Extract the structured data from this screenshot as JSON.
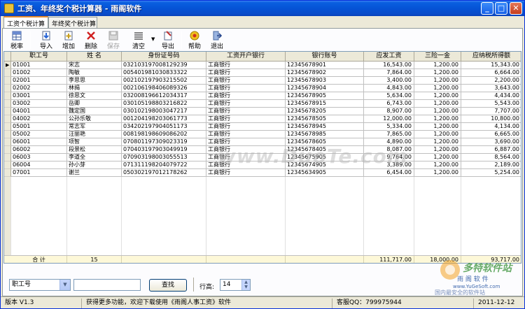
{
  "window": {
    "title": "工资、年终奖个税计算器 - 雨阁软件",
    "min_glyph": "_",
    "max_glyph": "□",
    "close_glyph": "✕"
  },
  "tabs": [
    {
      "label": "工资个税计算",
      "active": true
    },
    {
      "label": "年终奖个税计算",
      "active": false
    }
  ],
  "toolbar": {
    "items": [
      {
        "label": "税率",
        "icon": "tax-rate-table-icon",
        "enabled": true
      },
      {
        "label": "导入",
        "icon": "import-icon",
        "enabled": true
      },
      {
        "label": "增加",
        "icon": "add-icon",
        "enabled": true
      },
      {
        "label": "删除",
        "icon": "delete-icon",
        "enabled": true
      },
      {
        "label": "保存",
        "icon": "save-icon",
        "enabled": false
      },
      {
        "label": "清空",
        "icon": "clear-icon",
        "enabled": true
      },
      {
        "label": "导出",
        "icon": "export-icon",
        "enabled": true
      },
      {
        "label": "帮助",
        "icon": "help-icon",
        "enabled": true
      },
      {
        "label": "退出",
        "icon": "exit-icon",
        "enabled": true
      }
    ],
    "clear_dropdown_glyph": "▼"
  },
  "grid": {
    "columns": [
      "职工号",
      "姓 名",
      "身份证号码",
      "工资开户银行",
      "银行账号",
      "应发工资",
      "三险一金",
      "应纳税所得额"
    ],
    "current_row_marker": "▶",
    "rows": [
      [
        "01001",
        "宋志",
        "032103197008129239",
        "工商银行",
        "12345678901",
        "16,543.00",
        "1,200.00",
        "15,343.00"
      ],
      [
        "01002",
        "陶敏",
        "005401981030833322",
        "工商银行",
        "12345678902",
        "7,864.00",
        "1,200.00",
        "6,664.00"
      ],
      [
        "02001",
        "李思思",
        "002102197903215502",
        "工商银行",
        "12345678903",
        "3,400.00",
        "1,200.00",
        "2,200.00"
      ],
      [
        "02002",
        "林揭",
        "002106198406089326",
        "工商银行",
        "12345678904",
        "4,843.00",
        "1,200.00",
        "3,643.00"
      ],
      [
        "03001",
        "徐思文",
        "032008196612034317",
        "工商银行",
        "12345678905",
        "5,634.00",
        "1,200.00",
        "4,434.00"
      ],
      [
        "03002",
        "岳卿",
        "030105198803216822",
        "工商银行",
        "12345678915",
        "6,743.00",
        "1,200.00",
        "5,543.00"
      ],
      [
        "04001",
        "魏定国",
        "030102198003047217",
        "工商银行",
        "12345678205",
        "8,907.00",
        "1,200.00",
        "7,707.00"
      ],
      [
        "04002",
        "公孙乐敬",
        "001204198203061773",
        "工商银行",
        "12345678505",
        "12,000.00",
        "1,200.00",
        "10,800.00"
      ],
      [
        "05001",
        "常志军",
        "034202197904051173",
        "工商银行",
        "12345678945",
        "5,334.00",
        "1,200.00",
        "4,134.00"
      ],
      [
        "05002",
        "汪丽艳",
        "008198198609086202",
        "工商银行",
        "12345678985",
        "7,865.00",
        "1,200.00",
        "6,665.00"
      ],
      [
        "06001",
        "项智",
        "070801197309023319",
        "工商银行",
        "12345678605",
        "4,890.00",
        "1,200.00",
        "3,690.00"
      ],
      [
        "06002",
        "段景松",
        "070403197903049919",
        "工商银行",
        "12345678405",
        "8,087.00",
        "1,200.00",
        "6,887.00"
      ],
      [
        "06003",
        "李道全",
        "070903198003055513",
        "工商银行",
        "12345675905",
        "9,764.00",
        "1,200.00",
        "8,564.00"
      ],
      [
        "06004",
        "孙小芽",
        "071311198204079722",
        "工商银行",
        "12345674905",
        "3,389.00",
        "1,200.00",
        "2,189.00"
      ],
      [
        "07001",
        "谢兰",
        "050302197012178262",
        "工商银行",
        "12345634905",
        "6,454.00",
        "1,200.00",
        "5,254.00"
      ]
    ],
    "summary": {
      "label": "合 计",
      "count": "15",
      "gross_total": "111,717.00",
      "insurance_total": "18,000.00",
      "taxable_total": "93,717.00"
    }
  },
  "search": {
    "field_selected": "职工号",
    "field_dropdown_glyph": "▼",
    "query_value": "",
    "search_button_label": "查找",
    "row_height_label": "行高:",
    "row_height_value": "14",
    "spin_up_glyph": "▲",
    "spin_down_glyph": "▼"
  },
  "watermarks": {
    "center_text": "www.DuoTe.com",
    "logo_line1": "多特软件站",
    "logo_line2": "雨 阁 软 件",
    "logo_line3": "www.YuGeSoft.com",
    "logo_line4": "国内最安全的软件站"
  },
  "statusbar": {
    "version": "版本 V1.3",
    "message": "获得更多功能，欢迎下载使用《雨阁人事工资》软件",
    "qq": "客服QQ：799975944",
    "date": "2011-12-12"
  },
  "colors": {
    "titlebar": "#0553d6",
    "summary_row_bg": "#fdf8d8",
    "header_bg": "#ece9d8"
  }
}
